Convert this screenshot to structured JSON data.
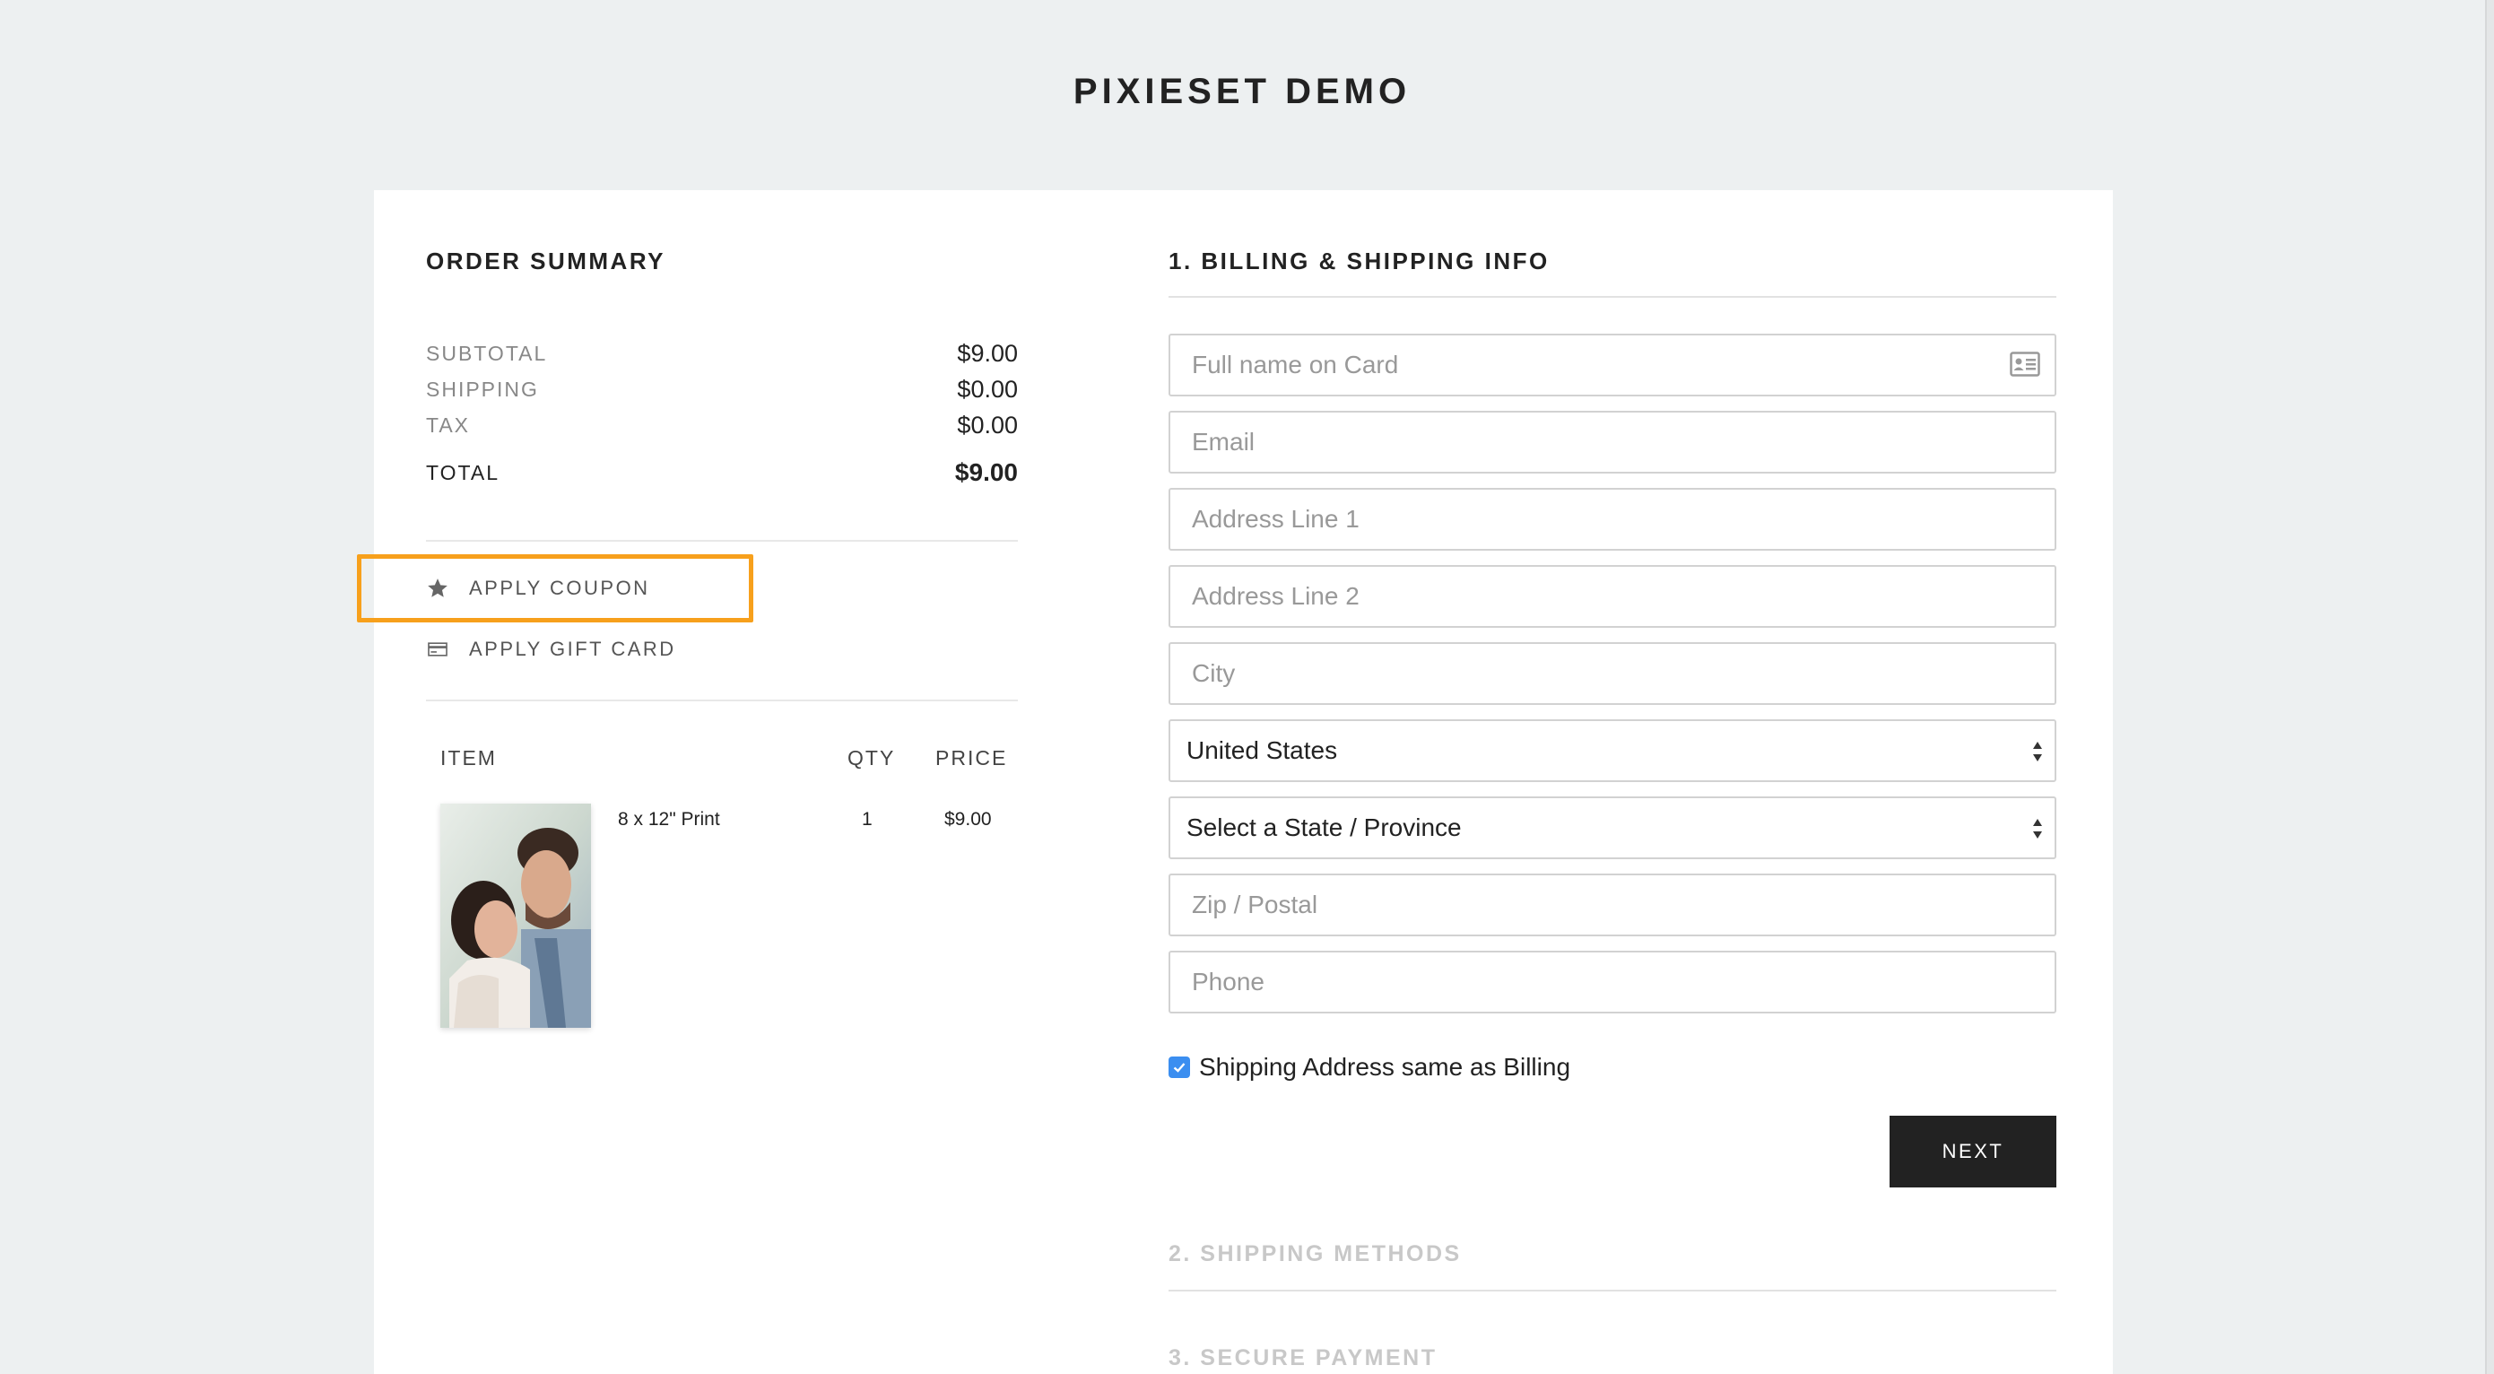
{
  "brand": "PIXIESET DEMO",
  "order_summary": {
    "title": "ORDER SUMMARY",
    "rows": [
      {
        "label": "SUBTOTAL",
        "value": "$9.00"
      },
      {
        "label": "SHIPPING",
        "value": "$0.00"
      },
      {
        "label": "TAX",
        "value": "$0.00"
      }
    ],
    "total": {
      "label": "TOTAL",
      "value": "$9.00"
    },
    "apply_coupon": "APPLY COUPON",
    "apply_gift_card": "APPLY GIFT CARD",
    "items_header": {
      "item": "ITEM",
      "qty": "QTY",
      "price": "PRICE"
    },
    "items": [
      {
        "name": "8 x 12\" Print",
        "qty": "1",
        "price": "$9.00"
      }
    ]
  },
  "billing": {
    "title": "1. BILLING & SHIPPING INFO",
    "placeholders": {
      "full_name": "Full name on Card",
      "email": "Email",
      "address1": "Address Line 1",
      "address2": "Address Line 2",
      "city": "City",
      "zip": "Zip / Postal",
      "phone": "Phone"
    },
    "country": "United States",
    "state": "Select a State / Province",
    "same_as_billing": "Shipping Address same as Billing",
    "next": "NEXT"
  },
  "steps": {
    "shipping_methods": "2. SHIPPING METHODS",
    "secure_payment": "3. SECURE PAYMENT"
  },
  "colors": {
    "highlight": "#f7a01c",
    "checkbox": "#3b8ef0",
    "button": "#222222"
  }
}
